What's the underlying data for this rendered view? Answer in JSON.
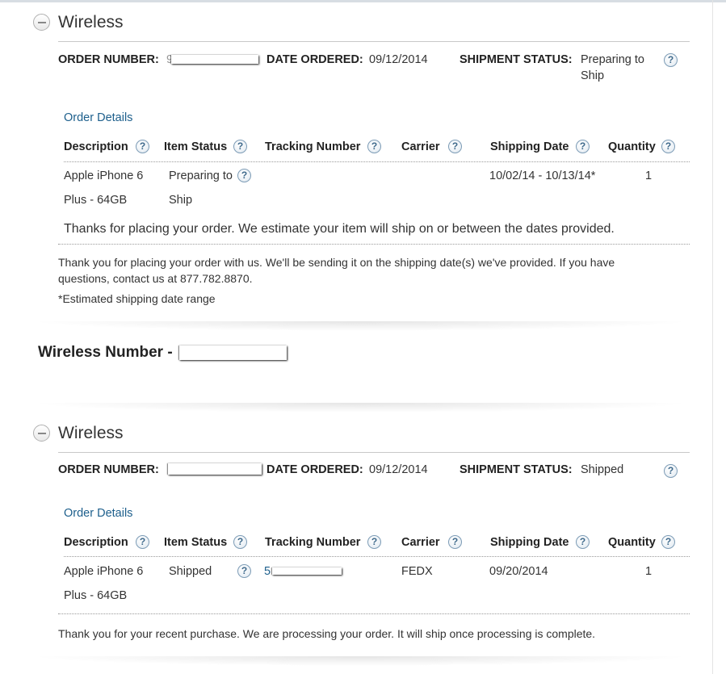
{
  "orders": [
    {
      "section_title": "Wireless",
      "order_number_label": "ORDER NUMBER:",
      "order_number_visible": "9",
      "date_ordered_label": "DATE ORDERED:",
      "date_ordered": "09/12/2014",
      "shipment_status_label": "SHIPMENT STATUS:",
      "shipment_status_line1": "Preparing to",
      "shipment_status_line2": "Ship",
      "order_details_link": "Order Details",
      "columns": [
        "Description",
        "Item Status",
        "Tracking Number",
        "Carrier",
        "Shipping Date",
        "Quantity"
      ],
      "row": {
        "description_line1": "Apple iPhone 6",
        "description_line2": "Plus - 64GB",
        "item_status_line1": "Preparing to",
        "item_status_line2": "Ship",
        "tracking_number": "",
        "carrier": "",
        "shipping_date": "10/02/14 - 10/13/14*",
        "quantity": "1"
      },
      "row_note": "Thanks for placing your order. We estimate your item will ship on or between the dates provided.",
      "footer_line1": "Thank you for placing your order with us. We'll be sending it on the shipping date(s) we've provided. If you have",
      "footer_line2": "questions, contact us at 877.782.8870.",
      "footnote": "*Estimated shipping date range"
    },
    {
      "section_title": "Wireless",
      "order_number_label": "ORDER NUMBER:",
      "date_ordered_label": "DATE ORDERED:",
      "date_ordered": "09/12/2014",
      "shipment_status_label": "SHIPMENT STATUS:",
      "shipment_status": "Shipped",
      "order_details_link": "Order Details",
      "columns": [
        "Description",
        "Item Status",
        "Tracking Number",
        "Carrier",
        "Shipping Date",
        "Quantity"
      ],
      "row": {
        "description_line1": "Apple iPhone 6",
        "description_line2": "Plus - 64GB",
        "item_status": "Shipped",
        "tracking_number_visible": "5",
        "carrier": "FEDX",
        "shipping_date": "09/20/2014",
        "quantity": "1"
      },
      "footer_line1": "Thank you for your recent purchase. We are processing your order. It will ship once processing is complete."
    }
  ],
  "wireless_number_label": "Wireless Number -",
  "help_glyph": "?",
  "icons": {
    "collapse": "minus-circle-icon",
    "help": "question-circle-icon"
  }
}
